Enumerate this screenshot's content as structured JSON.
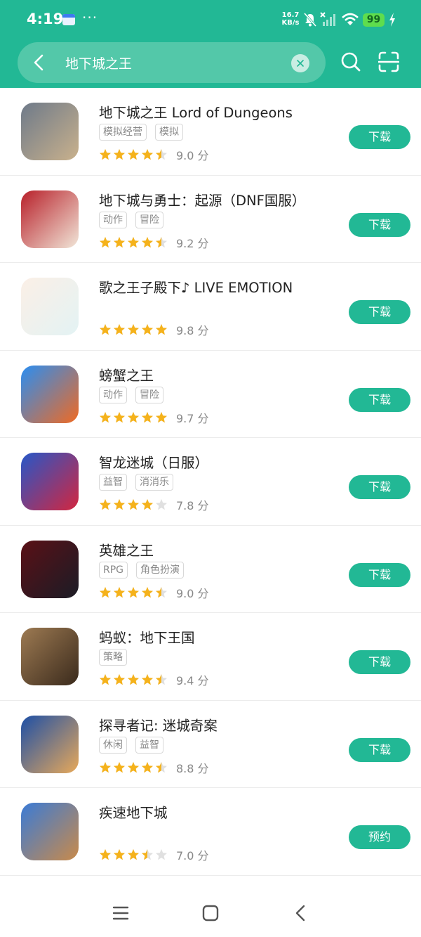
{
  "status_bar": {
    "time": "4:19",
    "dots": "···",
    "net_speed_value": "16.7",
    "net_speed_unit": "KB/s",
    "battery": "99",
    "icons": [
      "calendar-icon",
      "mute-bell-icon",
      "no-signal-icon",
      "wifi-icon",
      "battery-icon",
      "charging-icon"
    ]
  },
  "search": {
    "query": "地下城之王",
    "icons": [
      "back-arrow-icon",
      "clear-icon",
      "search-icon",
      "scan-icon"
    ]
  },
  "apps": [
    {
      "name": "地下城之王 Lord of Dungeons",
      "tags": [
        "模拟经营",
        "模拟"
      ],
      "stars": 4.5,
      "score": "9.0 分",
      "action": "下载",
      "icon_colors": [
        "#6e7a8a",
        "#c9b18c"
      ]
    },
    {
      "name": "地下城与勇士：起源（DNF国服）",
      "tags": [
        "动作",
        "冒险"
      ],
      "stars": 4.5,
      "score": "9.2 分",
      "action": "下载",
      "icon_colors": [
        "#b8202a",
        "#f1e6d8"
      ]
    },
    {
      "name": "歌之王子殿下♪ LIVE EMOTION",
      "tags": [],
      "stars": 5,
      "score": "9.8 分",
      "action": "下载",
      "icon_colors": [
        "#fbefe6",
        "#e3f3f4"
      ]
    },
    {
      "name": "螃蟹之王",
      "tags": [
        "动作",
        "冒险"
      ],
      "stars": 5,
      "score": "9.7 分",
      "action": "下载",
      "icon_colors": [
        "#2a8ef2",
        "#f06a22"
      ]
    },
    {
      "name": "智龙迷城（日服）",
      "tags": [
        "益智",
        "消消乐"
      ],
      "stars": 4,
      "score": "7.8 分",
      "action": "下载",
      "icon_colors": [
        "#2657c8",
        "#d3263f"
      ]
    },
    {
      "name": "英雄之王",
      "tags": [
        "RPG",
        "角色扮演"
      ],
      "stars": 4.5,
      "score": "9.0 分",
      "action": "下载",
      "icon_colors": [
        "#5a1016",
        "#1b1c26"
      ]
    },
    {
      "name": "蚂蚁：地下王国",
      "tags": [
        "策略"
      ],
      "stars": 4.5,
      "score": "9.4 分",
      "action": "下载",
      "icon_colors": [
        "#9d7a52",
        "#3a2a1c"
      ]
    },
    {
      "name": "探寻者记: 迷城奇案",
      "tags": [
        "休闲",
        "益智"
      ],
      "stars": 4.5,
      "score": "8.8 分",
      "action": "下载",
      "icon_colors": [
        "#1d4fa6",
        "#e8a95a"
      ]
    },
    {
      "name": "疾速地下城",
      "tags": [],
      "stars": 3.5,
      "score": "7.0 分",
      "action": "预约",
      "icon_colors": [
        "#3a7bd6",
        "#c98a4a"
      ]
    }
  ],
  "nav": {
    "icons": [
      "menu-icon",
      "home-icon",
      "back-icon"
    ]
  },
  "colors": {
    "accent": "#22b895",
    "star": "#f5b21b",
    "star_empty": "#e0e0e0"
  }
}
